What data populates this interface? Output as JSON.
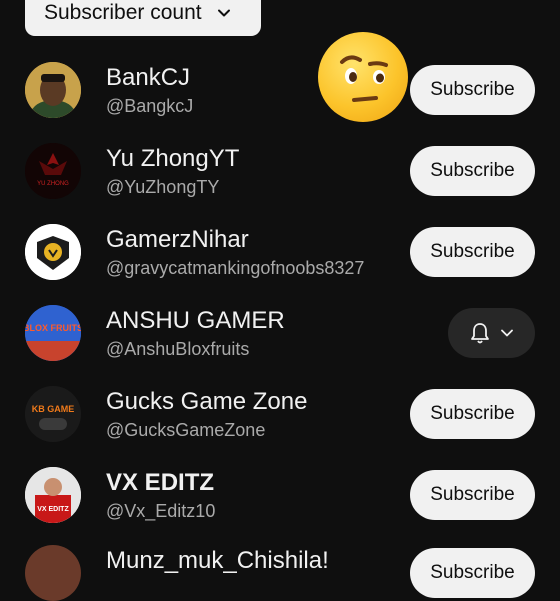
{
  "sort": {
    "label": "Subscriber count",
    "icon": "chevron-down-icon"
  },
  "reaction_sticker": {
    "icon": "face-with-raised-eyebrow-emoji"
  },
  "channels": [
    {
      "name": "BankCJ",
      "handle": "@BangkcJ",
      "action": "Subscribe"
    },
    {
      "name": "Yu ZhongYT",
      "handle": "@YuZhongTY",
      "action": "Subscribe",
      "avatar_text": "YU ZHONG"
    },
    {
      "name": "GamerzNihar",
      "handle": "@gravycatmankingofnoobs8327",
      "action": "Subscribe"
    },
    {
      "name": "ANSHU GAMER",
      "handle": "@AnshuBloxfruits",
      "action": "Subscribed (notifications)",
      "avatar_text": "BLOX FRUITS"
    },
    {
      "name": "Gucks Game Zone",
      "handle": "@GucksGameZone",
      "action": "Subscribe",
      "avatar_text": "KB GAME"
    },
    {
      "name": "VX EDITZ",
      "handle": "@Vx_Editz10",
      "action": "Subscribe",
      "avatar_text": "VX EDITZ"
    },
    {
      "name": "Munz_muk_Chishila!",
      "action": "Subscribe"
    }
  ],
  "colors": {
    "background": "#0f0f0f",
    "button_light": "#f1f1f1",
    "button_dark": "#272727",
    "handle_text": "#aaaaaa"
  }
}
